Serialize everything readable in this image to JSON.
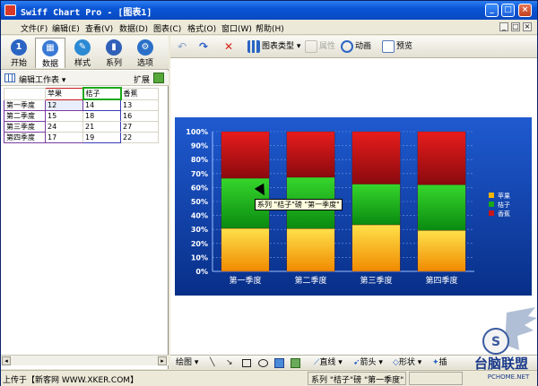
{
  "window": {
    "title": "Swiff Chart Pro - [图表1]",
    "controls": [
      "_",
      "□",
      "×"
    ]
  },
  "menubar": {
    "items": [
      "文件(F)",
      "编辑(E)",
      "查看(V)",
      "数据(D)",
      "图表(C)",
      "格式(O)",
      "窗口(W)",
      "帮助(H)"
    ],
    "mdi_controls": [
      "_",
      "□",
      "×"
    ]
  },
  "left_tabs": [
    {
      "label": "开始",
      "icon": "start-icon",
      "glyph": "1",
      "color": "#2b65c4"
    },
    {
      "label": "数据",
      "icon": "data-icon",
      "glyph": "▦",
      "color": "#3a7ad6"
    },
    {
      "label": "样式",
      "icon": "style-icon",
      "glyph": "✎",
      "color": "#2b8ad4"
    },
    {
      "label": "系列",
      "icon": "series-icon",
      "glyph": "▮",
      "color": "#3060b8"
    },
    {
      "label": "选项",
      "icon": "options-icon",
      "glyph": "⚙",
      "color": "#2a70c8"
    }
  ],
  "sheetbar": {
    "label": "编辑工作表 ▾",
    "expand": "扩展"
  },
  "sheet": {
    "headers": [
      "",
      "苹果",
      "桔子",
      "香蕉"
    ],
    "rows": [
      [
        "第一季度",
        "12",
        "14",
        "13"
      ],
      [
        "第二季度",
        "15",
        "18",
        "16"
      ],
      [
        "第三季度",
        "24",
        "21",
        "27"
      ],
      [
        "第四季度",
        "17",
        "19",
        "22"
      ]
    ]
  },
  "toolbar": {
    "undo": "↶",
    "redo": "↷",
    "delete": "✕",
    "chart_type": "图表类型",
    "properties": "属性",
    "animation": "动画",
    "preview": "预览"
  },
  "tooltip": "系列 \"桔子\"磅 \"第一季度\"",
  "bottombar": {
    "draw": "绘图 ▾",
    "line": "直线",
    "arrow": "箭头",
    "shape": "形状",
    "insert": "插"
  },
  "statusbar": {
    "left": "上传于【新客网 WWW.XKER.COM】",
    "hint": "系列 \"桔子\"磅 \"第一季度\""
  },
  "logo": {
    "text": "台脑联盟",
    "site": "PCHOME.NET"
  },
  "colors": {
    "chart_bg": "#0d3a9a",
    "apple": "#f5b400",
    "orange": "#1aa818",
    "banana": "#c8161b"
  },
  "chart_data": {
    "type": "bar",
    "stacked": "percent",
    "categories": [
      "第一季度",
      "第二季度",
      "第三季度",
      "第四季度"
    ],
    "series": [
      {
        "name": "苹果",
        "values": [
          12,
          15,
          24,
          17
        ]
      },
      {
        "name": "桔子",
        "values": [
          14,
          18,
          21,
          19
        ]
      },
      {
        "name": "香蕉",
        "values": [
          13,
          16,
          27,
          22
        ]
      }
    ],
    "yticks": [
      "0%",
      "10%",
      "20%",
      "30%",
      "40%",
      "50%",
      "60%",
      "70%",
      "80%",
      "90%",
      "100%"
    ],
    "ylim": [
      0,
      100
    ],
    "grid": true,
    "legend": "right"
  }
}
